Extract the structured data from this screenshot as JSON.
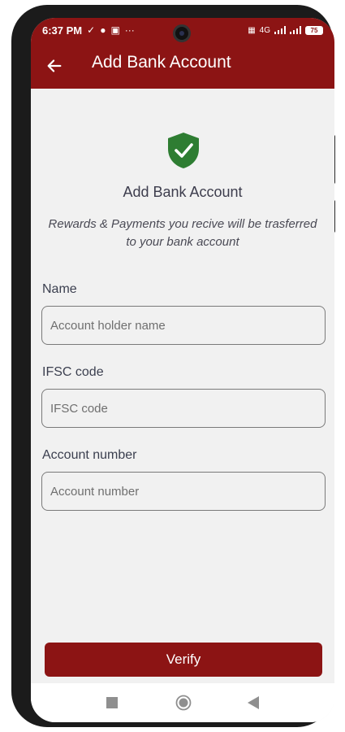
{
  "status_bar": {
    "time": "6:37 PM",
    "network": "4G",
    "battery": "75"
  },
  "app_bar": {
    "title": "Add Bank Account"
  },
  "content": {
    "heading": "Add Bank Account",
    "subtitle_line1": "Rewards & Payments you recive will be trasferred",
    "subtitle_line2": "to your bank account"
  },
  "form": {
    "fields": [
      {
        "label": "Name",
        "placeholder": "Account holder name",
        "value": ""
      },
      {
        "label": "IFSC code",
        "placeholder": "IFSC code",
        "value": ""
      },
      {
        "label": "Account number",
        "placeholder": "Account number",
        "value": ""
      }
    ],
    "submit_label": "Verify"
  },
  "icons": {
    "back": "arrow-left-icon",
    "shield": "shield-check-icon",
    "nav_recents": "square-icon",
    "nav_home": "circle-icon",
    "nav_back": "triangle-back-icon"
  },
  "colors": {
    "brand": "#8c1414",
    "shield": "#2e7d32",
    "background": "#f1f1f1"
  }
}
